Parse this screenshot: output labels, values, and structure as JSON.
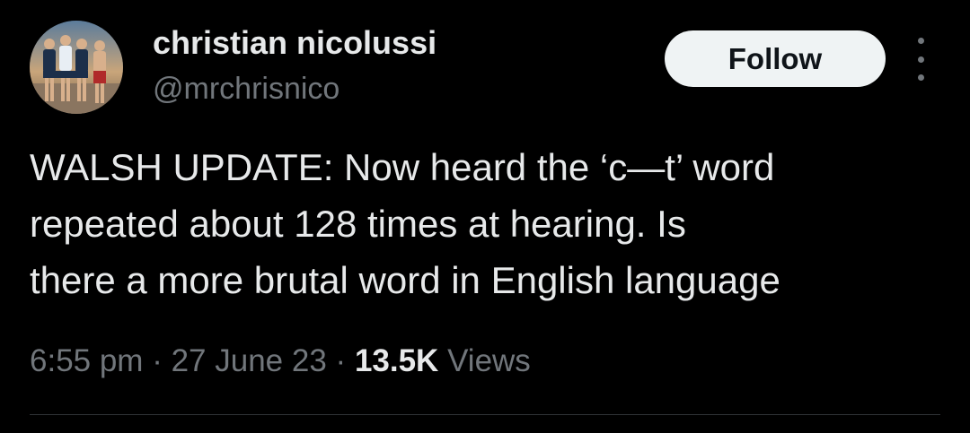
{
  "author": {
    "display_name": "christian nicolussi",
    "handle": "@mrchrisnico",
    "avatar_icon": "profile-photo-group-of-players"
  },
  "actions": {
    "follow_label": "Follow",
    "more_icon": "vertical-ellipsis-icon"
  },
  "tweet": {
    "text": "WALSH UPDATE: Now heard the ‘c—t’ word\nrepeated about 128 times at hearing. Is\nthere a more brutal word in English language"
  },
  "meta": {
    "time": "6:55 pm",
    "separator": "·",
    "date": "27 June 23",
    "views_count": "13.5K",
    "views_label": "Views"
  },
  "colors": {
    "background": "#000000",
    "primary_text": "#e7e9ea",
    "secondary_text": "#71767b",
    "follow_button_bg": "#eff3f4",
    "follow_button_text": "#0f1419",
    "divider": "#2f3336"
  }
}
